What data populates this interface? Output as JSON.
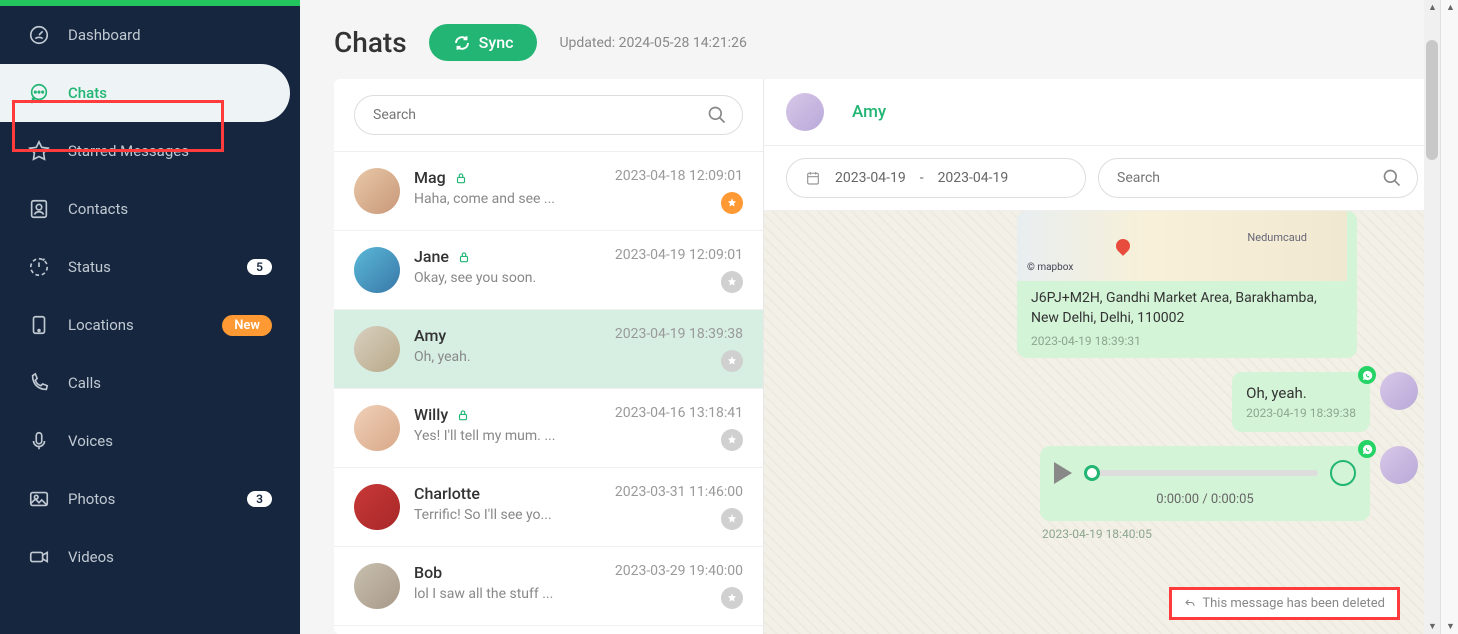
{
  "sidebar": {
    "items": [
      {
        "label": "Dashboard"
      },
      {
        "label": "Chats"
      },
      {
        "label": "Starred Messages"
      },
      {
        "label": "Contacts"
      },
      {
        "label": "Status",
        "badge": "5"
      },
      {
        "label": "Locations",
        "badge": "New"
      },
      {
        "label": "Calls"
      },
      {
        "label": "Voices"
      },
      {
        "label": "Photos",
        "badge": "3"
      },
      {
        "label": "Videos"
      }
    ]
  },
  "header": {
    "title": "Chats",
    "sync": "Sync",
    "updated": "Updated: 2024-05-28 14:21:26"
  },
  "search": {
    "placeholder": "Search"
  },
  "chats": [
    {
      "name": "Mag",
      "preview": "Haha, come and see ...",
      "time": "2023-04-18 12:09:01",
      "lock": true,
      "pinned": true
    },
    {
      "name": "Jane",
      "preview": "Okay, see you soon.",
      "time": "2023-04-19 12:09:01",
      "lock": true,
      "pinned": false
    },
    {
      "name": "Amy",
      "preview": "Oh, yeah.",
      "time": "2023-04-19 18:39:38",
      "lock": false,
      "pinned": false,
      "selected": true
    },
    {
      "name": "Willy",
      "preview": "Yes! I'll tell my mum. ...",
      "time": "2023-04-16 13:18:41",
      "lock": true,
      "pinned": false
    },
    {
      "name": "Charlotte",
      "preview": "Terrific! So I'll see yo...",
      "time": "2023-03-31 11:46:00",
      "lock": false,
      "pinned": false
    },
    {
      "name": "Bob",
      "preview": "lol I saw all the stuff ...",
      "time": "2023-03-29 19:40:00",
      "lock": false,
      "pinned": false
    }
  ],
  "detail": {
    "name": "Amy",
    "date_from": "2023-04-19",
    "date_sep": "-",
    "date_to": "2023-04-19",
    "search_placeholder": "Search",
    "map_label_right": "Nedumcaud",
    "map_label_left": "© mapbox",
    "location_text": "J6PJ+M2H, Gandhi Market Area, Barakhamba, New Delhi, Delhi, 110002",
    "location_time": "2023-04-19 18:39:31",
    "msg_text": "Oh, yeah.",
    "msg_text_time": "2023-04-19 18:39:38",
    "audio_time": "0:00:00 / 0:00:05",
    "audio_msg_time": "2023-04-19 18:40:05",
    "deleted_text": "This message has been deleted"
  }
}
